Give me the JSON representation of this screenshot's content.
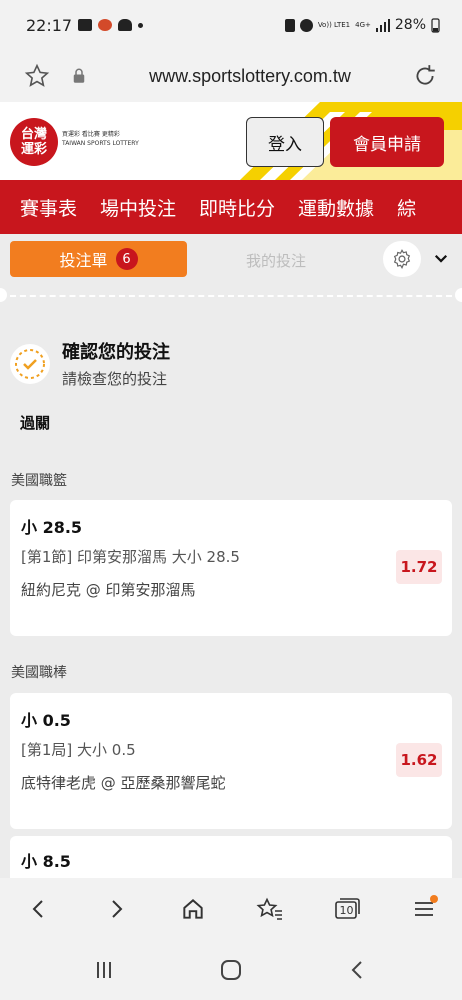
{
  "status_bar": {
    "time": "22:17",
    "battery": "28%",
    "volte_label": "Vo)) LTE1",
    "net_label": "4G+"
  },
  "browser": {
    "url": "www.sportslottery.com.tw",
    "tabs_count": "10"
  },
  "site": {
    "logo_line1": "台灣",
    "logo_line2": "運彩",
    "logo_slogan": "買運彩 看比賽 更精彩",
    "logo_en": "TAIWAN SPORTS LOTTERY",
    "login_label": "登入",
    "register_label": "會員申請"
  },
  "nav": [
    "賽事表",
    "場中投注",
    "即時比分",
    "運動數據",
    "綜"
  ],
  "bet_slip": {
    "tab_active": "投注單",
    "count": "6",
    "tab_inactive": "我的投注"
  },
  "confirm": {
    "title": "確認您的投注",
    "subtitle": "請檢查您的投注"
  },
  "parlay_label": "過關",
  "bets": [
    {
      "league": "美國職籃",
      "selection": "小 28.5",
      "market": "[第1節] 印第安那溜馬 大小 28.5",
      "match": "紐約尼克 @ 印第安那溜馬",
      "odds": "1.72"
    },
    {
      "league": "美國職棒",
      "selection": "小 0.5",
      "market": "[第1局] 大小 0.5",
      "match": "底特律老虎 @ 亞歷桑那響尾蛇",
      "odds": "1.62"
    }
  ],
  "peek_selection": "小 8.5",
  "colors": {
    "brand_red": "#c8161d",
    "accent_orange": "#f27d1f",
    "stripe_yellow": "#f5d000"
  }
}
